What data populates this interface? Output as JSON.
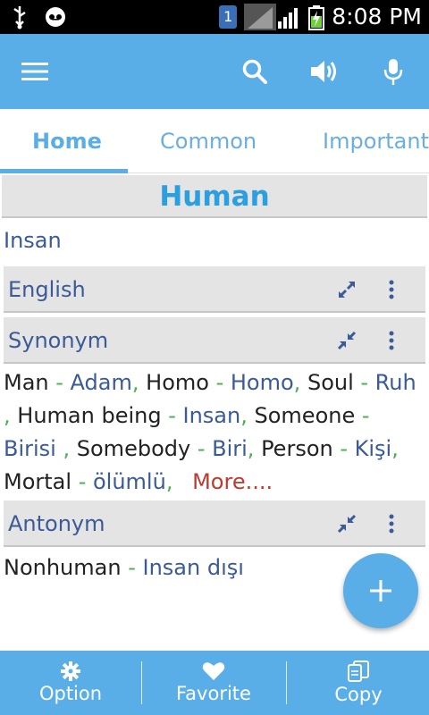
{
  "status_bar": {
    "time": "8:08 PM",
    "sim_badge": "1"
  },
  "toolbar": {
    "menu_icon": "hamburger-menu-icon",
    "search_icon": "search-icon",
    "speaker_icon": "speaker-icon",
    "mic_icon": "microphone-icon"
  },
  "tabs": [
    {
      "label": "Home",
      "active": true
    },
    {
      "label": "Common",
      "active": false
    },
    {
      "label": "Important",
      "active": false
    }
  ],
  "word": {
    "title": "Human",
    "translation": "Insan"
  },
  "sections": {
    "english": {
      "title": "English"
    },
    "synonym": {
      "title": "Synonym"
    },
    "antonym": {
      "title": "Antonym"
    }
  },
  "synonyms": [
    {
      "word": "Man",
      "translation": "Adam"
    },
    {
      "word": "Homo",
      "translation": "Homo"
    },
    {
      "word": "Soul",
      "translation": "Ruh"
    },
    {
      "word": "Human being",
      "translation": "Insan"
    },
    {
      "word": "Someone",
      "translation": "Birisi"
    },
    {
      "word": "Somebody",
      "translation": "Biri"
    },
    {
      "word": "Person",
      "translation": "Kişi"
    },
    {
      "word": "Mortal",
      "translation": "ölümlü"
    }
  ],
  "synonym_more": "More....",
  "antonyms": [
    {
      "word": "Nonhuman",
      "translation": "Insan dışı"
    }
  ],
  "separator": " - ",
  "comma": ",",
  "bottom_bar": {
    "option_label": "Option",
    "favorite_label": "Favorite",
    "copy_label": "Copy"
  },
  "colors": {
    "primary": "#5aaee8",
    "title": "#2b9fe0",
    "translation_text": "#3a5a98",
    "separator": "#4caf50",
    "more_link": "#c0392b"
  }
}
